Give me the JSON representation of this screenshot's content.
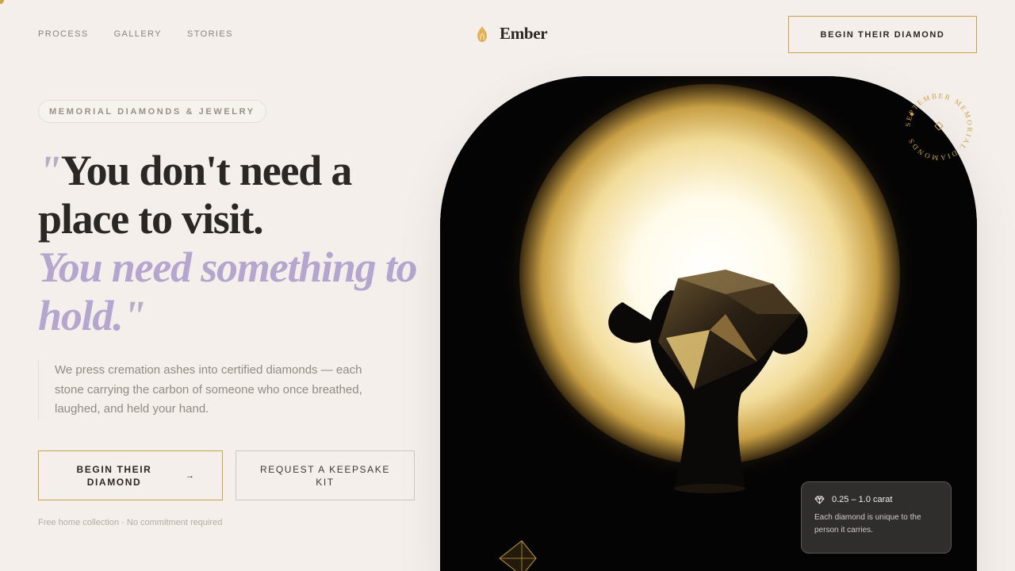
{
  "nav": {
    "links": [
      "PROCESS",
      "GALLERY",
      "STORIES"
    ],
    "brand": "Ember",
    "cta": "BEGIN THEIR DIAMOND"
  },
  "hero": {
    "badge": "MEMORIAL DIAMONDS & JEWELRY",
    "headline": {
      "quote_open": "\"",
      "line1": "You don't need a",
      "line2": "place to visit.",
      "accent_line1": "You need something to",
      "accent_line2": "hold.",
      "quote_close": "\""
    },
    "intro": "We press cremation ashes into certified diamonds — each stone carrying the carbon of someone who once breathed, laughed, and held your hand.",
    "primary_button": "BEGIN THEIR DIAMOND",
    "primary_arrow": "→",
    "secondary_button": "REQUEST A KEEPSAKE KIT",
    "fineprint": "Free home collection · No commitment required"
  },
  "seal": {
    "text": "SEPTEMBER MEMORIAL DIAMONDS"
  },
  "info_card": {
    "carat": "0.25 – 1.0 carat",
    "description": "Each diamond is unique to the person it carries."
  },
  "colors": {
    "background": "#f4efea",
    "gold": "#c9a24a",
    "lavender": "#b4a6cf",
    "ink": "#2b2724"
  },
  "icons": {
    "brand": "flame-icon",
    "card": "diamond-icon",
    "button_arrow": "arrow-right-icon"
  }
}
